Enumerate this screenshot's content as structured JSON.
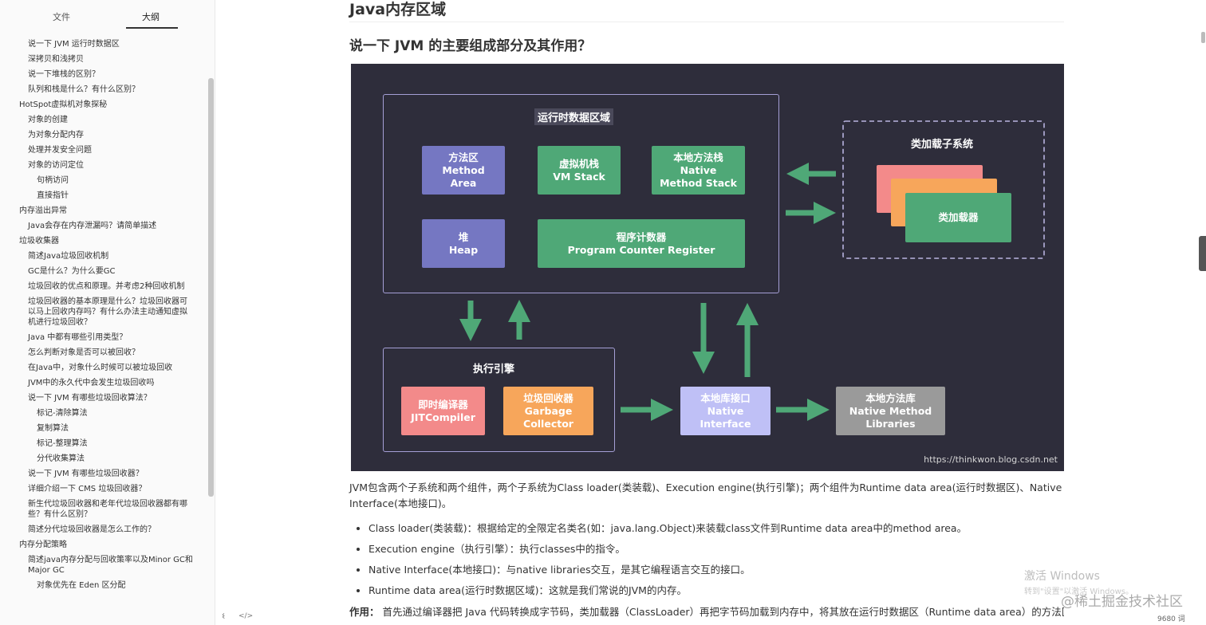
{
  "sidebar": {
    "tabs": {
      "files": "文件",
      "outline": "大纲"
    },
    "items": [
      {
        "label": "说一下 JVM 运行时数据区",
        "level": 2
      },
      {
        "label": "深拷贝和浅拷贝",
        "level": 2
      },
      {
        "label": "说一下堆栈的区别？",
        "level": 2
      },
      {
        "label": "队列和栈是什么？有什么区别？",
        "level": 2
      },
      {
        "label": "HotSpot虚拟机对象探秘",
        "level": 1
      },
      {
        "label": "对象的创建",
        "level": 2
      },
      {
        "label": "为对象分配内存",
        "level": 2
      },
      {
        "label": "处理并发安全问题",
        "level": 2
      },
      {
        "label": "对象的访问定位",
        "level": 2
      },
      {
        "label": "句柄访问",
        "level": 3
      },
      {
        "label": "直接指针",
        "level": 3
      },
      {
        "label": "内存溢出异常",
        "level": 1
      },
      {
        "label": "Java会存在内存泄漏吗？请简单描述",
        "level": 2
      },
      {
        "label": "垃圾收集器",
        "level": 1
      },
      {
        "label": "简述Java垃圾回收机制",
        "level": 2
      },
      {
        "label": "GC是什么？为什么要GC",
        "level": 2
      },
      {
        "label": "垃圾回收的优点和原理。并考虑2种回收机制",
        "level": 2
      },
      {
        "label": "垃圾回收器的基本原理是什么？垃圾回收器可以马上回收内存吗？有什么办法主动通知虚拟机进行垃圾回收？",
        "level": 2
      },
      {
        "label": "Java 中都有哪些引用类型？",
        "level": 2
      },
      {
        "label": "怎么判断对象是否可以被回收？",
        "level": 2
      },
      {
        "label": "在Java中，对象什么时候可以被垃圾回收",
        "level": 2
      },
      {
        "label": "JVM中的永久代中会发生垃圾回收吗",
        "level": 2
      },
      {
        "label": "说一下 JVM 有哪些垃圾回收算法？",
        "level": 2
      },
      {
        "label": "标记-清除算法",
        "level": 3
      },
      {
        "label": "复制算法",
        "level": 3
      },
      {
        "label": "标记-整理算法",
        "level": 3
      },
      {
        "label": "分代收集算法",
        "level": 3
      },
      {
        "label": "说一下 JVM 有哪些垃圾回收器？",
        "level": 2
      },
      {
        "label": "详细介绍一下 CMS 垃圾回收器？",
        "level": 2
      },
      {
        "label": "新生代垃圾回收器和老年代垃圾回收器都有哪些？有什么区别？",
        "level": 2
      },
      {
        "label": "简述分代垃圾回收器是怎么工作的？",
        "level": 2
      },
      {
        "label": "内存分配策略",
        "level": 1
      },
      {
        "label": "简述java内存分配与回收策率以及Minor GC和Major GC",
        "level": 2
      },
      {
        "label": "对象优先在 Eden 区分配",
        "level": 3
      }
    ],
    "footer": {
      "back": "‹",
      "code": "</>"
    }
  },
  "article": {
    "h1": "Java内存区域",
    "h2": "说一下 JVM 的主要组成部分及其作用？",
    "diagram": {
      "runtime_title": "运行时数据区域",
      "method_area": [
        "方法区",
        "Method",
        "Area"
      ],
      "vm_stack": [
        "虚拟机栈",
        "VM Stack"
      ],
      "native_stack": [
        "本地方法栈",
        "Native",
        "Method Stack"
      ],
      "heap": [
        "堆",
        "Heap"
      ],
      "pc": [
        "程序计数器",
        "Program Counter Register"
      ],
      "classloader_title": "类加载子系统",
      "classloader_box": "类加载器",
      "engine_title": "执行引擎",
      "jit": [
        "即时编译器",
        "JITCompiler"
      ],
      "gc": [
        "垃圾回收器",
        "Garbage",
        "Collector"
      ],
      "native_interface": [
        "本地库接口",
        "Native",
        "Interface"
      ],
      "native_libs": [
        "本地方法库",
        "Native Method",
        "Libraries"
      ],
      "url": "https://thinkwon.blog.csdn.net",
      "colors": {
        "bg": "#2e2d3b",
        "purple": "#7577c2",
        "green": "#4fa877",
        "pink": "#f38a8a",
        "orange": "#f7a65b",
        "lavender": "#bfc0f6",
        "gray": "#9a9a9a",
        "frame": "#a59fd6",
        "arrow": "#4fa877"
      }
    },
    "para1": "JVM包含两个子系统和两个组件，两个子系统为Class loader(类装载)、Execution engine(执行引擎)；两个组件为Runtime data area(运行时数据区)、Native Interface(本地接口)。",
    "bullets": [
      "Class loader(类装载)：根据给定的全限定名类名(如：java.lang.Object)来装载class文件到Runtime data area中的method area。",
      "Execution engine（执行引擎）：执行classes中的指令。",
      "Native Interface(本地接口)：与native libraries交互，是其它编程语言交互的接口。",
      "Runtime data area(运行时数据区域)：这就是我们常说的JVM的内存。"
    ],
    "para2_label": "作用：",
    "para2_text": "首先通过编译器把 Java 代码转换成字节码，类加载器（ClassLoader）再把字节码加载到内存中，将其放在运行时数据区（Runtime data area）的方法区"
  },
  "overlay": {
    "activate_title": "激活 Windows",
    "activate_sub": "转到\"设置\"以激活 Windows。",
    "juejin": "@稀土掘金技术社区",
    "word_count": "9680 词"
  }
}
